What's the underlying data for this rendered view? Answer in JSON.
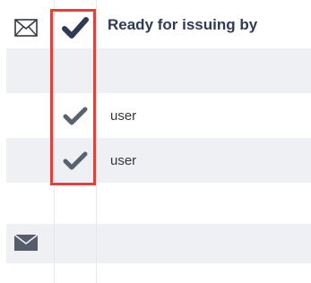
{
  "header": {
    "mail_icon": "envelope-outline-icon",
    "check_icon": "checkmark-icon",
    "column_title": "Ready for issuing by"
  },
  "rows": [
    {
      "checked": false,
      "user": ""
    },
    {
      "checked": true,
      "user": "user"
    },
    {
      "checked": true,
      "user": "user"
    },
    {
      "checked": false,
      "user": ""
    },
    {
      "checked": false,
      "user": "",
      "mail_icon": "envelope-filled-icon"
    }
  ],
  "colors": {
    "stripe": "#eef0f4",
    "check_dark": "#2f3b55",
    "check_gray": "#5a6170",
    "highlight": "#e0413c"
  }
}
